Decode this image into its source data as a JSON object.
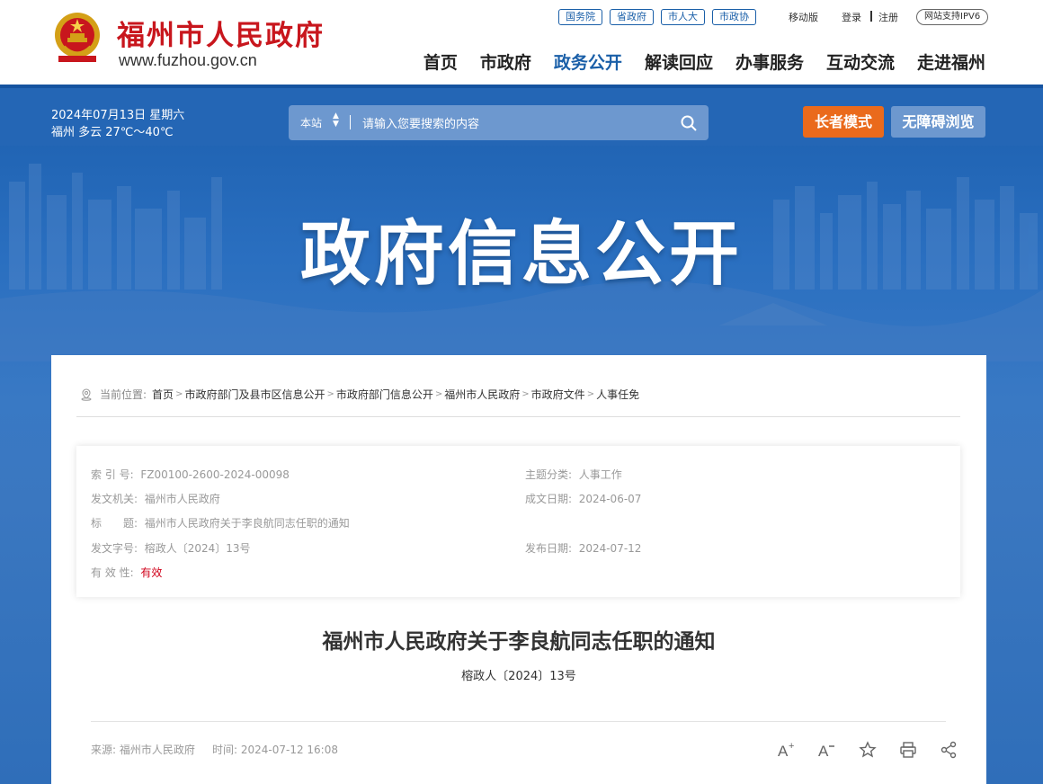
{
  "header": {
    "site_name": "福州市人民政府",
    "site_url": "www.fuzhou.gov.cn",
    "top_links": [
      "国务院",
      "省政府",
      "市人大",
      "市政协"
    ],
    "mobile": "移动版",
    "login": "登录",
    "register": "注册",
    "ipv6": "网站支持IPV6",
    "nav": [
      "首页",
      "市政府",
      "政务公开",
      "解读回应",
      "办事服务",
      "互动交流",
      "走进福州"
    ],
    "nav_active": "政务公开"
  },
  "band": {
    "date": "2024年07月13日 星期六",
    "weather": "福州 多云 27℃～40℃",
    "search_scope": "本站",
    "search_placeholder": "请输入您要搜索的内容",
    "elder_mode": "长者模式",
    "accessible": "无障碍浏览"
  },
  "hero_title": "政府信息公开",
  "breadcrumb": {
    "label": "当前位置:",
    "items": [
      "首页",
      "市政府部门及县市区信息公开",
      "市政府部门信息公开",
      "福州市人民政府",
      "市政府文件",
      "人事任免"
    ]
  },
  "meta": {
    "index_label": "索 引 号:",
    "index_value": "FZ00100-2600-2024-00098",
    "topic_label": "主题分类:",
    "topic_value": "人事工作",
    "issuer_label": "发文机关:",
    "issuer_value": "福州市人民政府",
    "written_label": "成文日期:",
    "written_value": "2024-06-07",
    "title_label": "标　　题:",
    "title_value": "福州市人民政府关于李良航同志任职的通知",
    "docno_label": "发文字号:",
    "docno_value": "榕政人〔2024〕13号",
    "published_label": "发布日期:",
    "published_value": "2024-07-12",
    "validity_label": "有 效 性:",
    "validity_value": "有效"
  },
  "document": {
    "title": "福州市人民政府关于李良航同志任职的通知",
    "number": "榕政人〔2024〕13号",
    "source_label": "来源:",
    "source_value": "福州市人民政府",
    "time_label": "时间:",
    "time_value": "2024-07-12 16:08"
  },
  "colors": {
    "brand_red": "#c8161d",
    "brand_blue": "#1a5fa8",
    "orange": "#ea6a1c"
  }
}
